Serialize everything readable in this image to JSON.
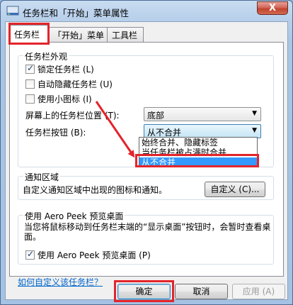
{
  "window": {
    "title": "任务栏和「开始」菜单属性",
    "close_glyph": "X"
  },
  "tabs": [
    {
      "label": "任务栏",
      "active": true
    },
    {
      "label": "「开始」菜单",
      "active": false
    },
    {
      "label": "工具栏",
      "active": false
    }
  ],
  "appearance": {
    "group_title": "任务栏外观",
    "checkboxes": [
      {
        "label": "锁定任务栏 (L)",
        "checked": true
      },
      {
        "label": "自动隐藏任务栏 (U)",
        "checked": false
      },
      {
        "label": "使用小图标 (I)",
        "checked": false
      }
    ],
    "position_label": "屏幕上的任务栏位置 (T):",
    "position_value": "底部",
    "buttons_label": "任务栏按钮 (B):",
    "buttons_value": "从不合并",
    "dropdown_options": [
      {
        "label": "始终合并、隐藏标签",
        "selected": false
      },
      {
        "label": "当任务栏被占满时合并",
        "selected": false
      },
      {
        "label": "从不合并",
        "selected": true
      }
    ]
  },
  "notification": {
    "group_title": "通知区域",
    "description": "自定义通知区域中出现的图标和通知。",
    "customize_button": "自定义 (C)..."
  },
  "aero_peek": {
    "group_title": "使用 Aero Peek 预览桌面",
    "description": "当您将鼠标移动到任务栏末端的“显示桌面”按钮时，会暂时查看桌面。",
    "checkbox_label": "使用 Aero Peek 预览桌面 (P)",
    "checked": true
  },
  "help_link": "如何自定义该任务栏？",
  "footer": {
    "ok": "确定",
    "cancel": "取消",
    "apply": "应用 (A)"
  },
  "colors": {
    "highlight": "#e3242b",
    "selection": "#3399ff",
    "link": "#0066cc"
  }
}
